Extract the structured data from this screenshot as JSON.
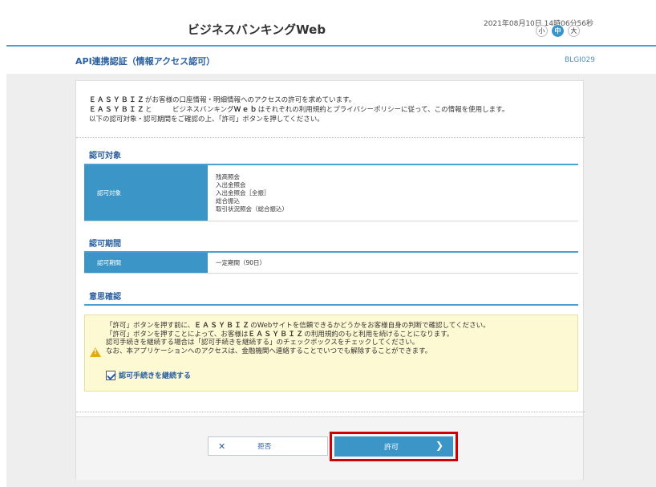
{
  "header": {
    "app_title": "ビジネスバンキングWeb",
    "datetime": "2021年08月10日 14時06分56秒",
    "size_small": "小",
    "size_medium": "中",
    "size_large": "大"
  },
  "page": {
    "title": "API連携認証（情報アクセス認可）",
    "screen_id": "BLGI029"
  },
  "intro": {
    "brand": "ＥＡＳＹＢＩＺ",
    "line1_rest": "がお客様の口座情報・明細情報へのアクセスの許可を求めています。",
    "line2_brand": "ＥＡＳＹＢＩＺ",
    "line2_mid": "と　　　ビジネスバンキング",
    "line2_web": "Ｗｅｂ",
    "line2_rest": "はそれぞれの利用規約とプライバシーポリシーに従って、この情報を使用します。",
    "line3": "以下の認可対象・認可期間をご確認の上、「許可」ボタンを押してください。"
  },
  "scope_section": {
    "title": "認可対象",
    "label": "認可対象",
    "items": [
      "残高照会",
      "入出金照会",
      "入出金照会［全振］",
      "総合振込",
      "取引状況照会（総合振込）"
    ]
  },
  "period_section": {
    "title": "認可期間",
    "label": "認可期間",
    "value": "一定期間（90日）"
  },
  "confirm_section": {
    "title": "意思確認",
    "line1_a": "「許可」ボタンを押す前に、",
    "line1_brand": "ＥＡＳＹＢＩＺ",
    "line1_b": "のWebサイトを信頼できるかどうかをお客様自身の判断で確認してください。",
    "line2_a": "「許可」ボタンを押すことによって、お客様は",
    "line2_brand": "ＥＡＳＹＢＩＺ",
    "line2_b": "の利用規約のもと利用を続けることになります。",
    "line3": "認可手続きを継続する場合は「認可手続きを継続する」のチェックボックスをチェックしてください。",
    "line4": "なお、本アプリケーションへのアクセスは、金融機関へ連絡することでいつでも解除することができます。",
    "checkbox_label": "認可手続きを継続する",
    "checkbox_checked": true
  },
  "buttons": {
    "reject_label": "拒否",
    "permit_label": "許可"
  },
  "colors": {
    "accent": "#3b96c7",
    "title_blue": "#2a5fa0",
    "notice_bg": "#fdf9d3",
    "highlight": "#d00000"
  }
}
